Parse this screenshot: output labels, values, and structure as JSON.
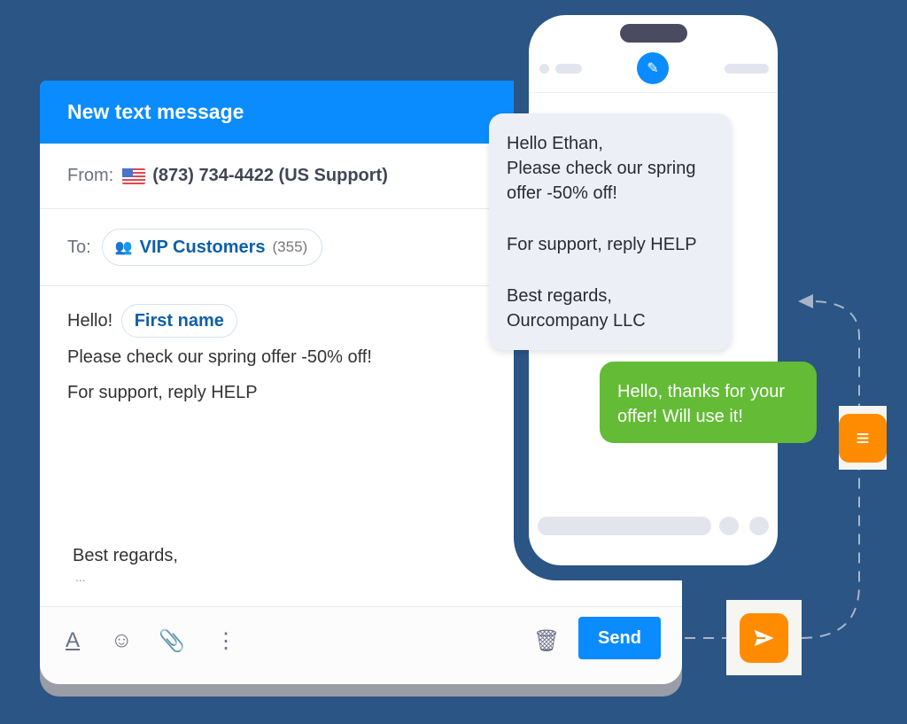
{
  "compose": {
    "title": "New text message",
    "from_label": "From:",
    "from_number": "(873) 734-4422 (US Support)",
    "to_label": "To:",
    "recipient": "VIP Customers",
    "recipient_count": "(355)",
    "greeting": "Hello!",
    "name_token": "First name",
    "line1": "Please check our spring offer -50% off!",
    "line2": "For support, reply HELP",
    "signoff": "Best regards,",
    "ellipsis": "...",
    "send_label": "Send"
  },
  "phone": {
    "incoming": [
      "Hello Ethan,",
      "Please check our spring",
      "offer -50% off!",
      "",
      "For support, reply HELP",
      "",
      "Best regards,",
      "Ourcompany LLC"
    ],
    "reply": [
      "Hello, thanks for your",
      "offer! Will use it!"
    ]
  },
  "colors": {
    "background": "#2a5585",
    "accent": "#0a8cff",
    "reply": "#63bb36",
    "badge": "#ff8c00"
  }
}
